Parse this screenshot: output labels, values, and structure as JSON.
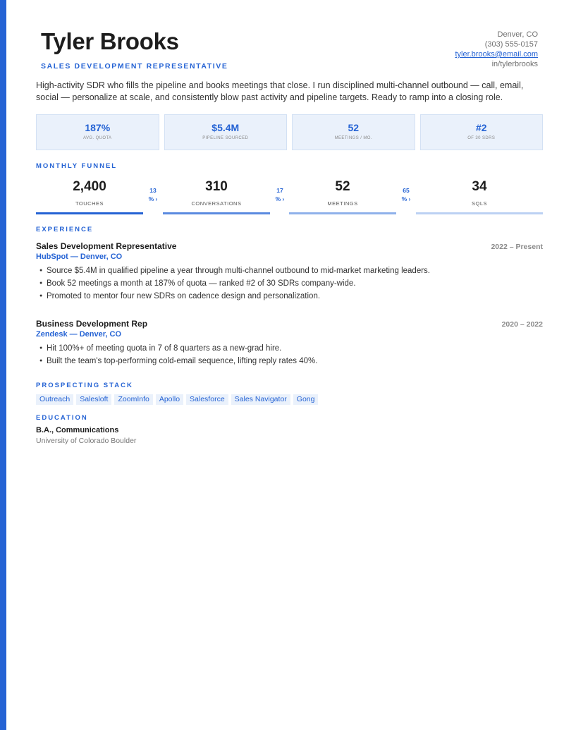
{
  "header": {
    "name": "Tyler Brooks",
    "role": "SALES DEVELOPMENT REPRESENTATIVE",
    "contact": {
      "location": "Denver, CO",
      "phone": "(303) 555-0157",
      "email": "tyler.brooks@email.com",
      "linkedin": "in/tylerbrooks"
    }
  },
  "summary": "High-activity SDR who fills the pipeline and books meetings that close. I run disciplined multi-channel outbound — call, email, social — personalize at scale, and consistently blow past activity and pipeline targets. Ready to ramp into a closing role.",
  "stats": [
    {
      "value": "187%",
      "label": "AVG. QUOTA"
    },
    {
      "value": "$5.4M",
      "label": "PIPELINE SOURCED"
    },
    {
      "value": "52",
      "label": "MEETINGS / MO."
    },
    {
      "value": "#2",
      "label": "OF 30 SDRS"
    }
  ],
  "funnel": {
    "title": "MONTHLY FUNNEL",
    "stages": [
      {
        "value": "2,400",
        "label": "TOUCHES"
      },
      {
        "value": "310",
        "label": "CONVERSATIONS"
      },
      {
        "value": "52",
        "label": "MEETINGS"
      },
      {
        "value": "34",
        "label": "SQLS"
      }
    ],
    "conversions": [
      {
        "line1": "13",
        "line2": "% ›"
      },
      {
        "line1": "17",
        "line2": "% ›"
      },
      {
        "line1": "65",
        "line2": "% ›"
      }
    ],
    "bar_colors": [
      "#2563d4",
      "#5b8ae0",
      "#8fb1ea",
      "#bcd1f3"
    ]
  },
  "experience": {
    "title": "EXPERIENCE",
    "jobs": [
      {
        "title": "Sales Development Representative",
        "dates": "2022 – Present",
        "company": "HubSpot — Denver, CO",
        "bullets": [
          "Source $5.4M in qualified pipeline a year through multi-channel outbound to mid-market marketing leaders.",
          "Book 52 meetings a month at 187% of quota — ranked #2 of 30 SDRs company-wide.",
          "Promoted to mentor four new SDRs on cadence design and personalization."
        ]
      },
      {
        "title": "Business Development Rep",
        "dates": "2020 – 2022",
        "company": "Zendesk — Denver, CO",
        "bullets": [
          "Hit 100%+ of meeting quota in 7 of 8 quarters as a new-grad hire.",
          "Built the team's top-performing cold-email sequence, lifting reply rates 40%."
        ]
      }
    ]
  },
  "stack": {
    "title": "PROSPECTING STACK",
    "tags": [
      "Outreach",
      "Salesloft",
      "ZoomInfo",
      "Apollo",
      "Salesforce",
      "Sales Navigator",
      "Gong"
    ]
  },
  "education": {
    "title": "EDUCATION",
    "degree": "B.A., Communications",
    "school": "University of Colorado Boulder"
  },
  "colors": {
    "accent": "#2563d4",
    "accent_light": "#eaf1fb"
  }
}
